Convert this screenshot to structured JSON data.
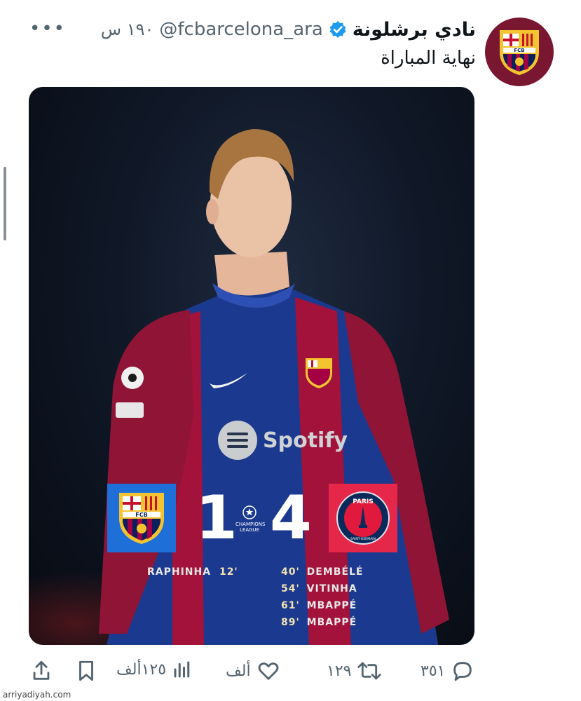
{
  "tweet": {
    "display_name": "نادي برشلونة",
    "handle": "@fcbarcelona_ara",
    "time": "١٩٠ س",
    "more_label": "•••",
    "text": "نهاية المباراة",
    "avatar_label": "FCB"
  },
  "scoreboard": {
    "home_score": "1",
    "away_score": "4",
    "competition": "CHAMPIONS LEAGUE",
    "home_crest_label": "FCB",
    "away_crest_label": "PARIS",
    "away_crest_sub": "SAINT-GERMAIN",
    "sponsor": "Spotify",
    "home_scorers": [
      {
        "player": "RAPHINHA",
        "minute": "12'"
      }
    ],
    "away_scorers": [
      {
        "minute": "40'",
        "player": "DEMBÉLÉ"
      },
      {
        "minute": "54'",
        "player": "VITINHA"
      },
      {
        "minute": "61'",
        "player": "MBAPPÉ"
      },
      {
        "minute": "89'",
        "player": "MBAPPÉ"
      }
    ]
  },
  "actions": {
    "replies": "٣٥١",
    "retweets": "١٢٩",
    "likes": "ألف",
    "views": "١٢٥ألف"
  },
  "watermark": "arriyadiyah.com",
  "colors": {
    "barca_blue": "#1f6fd8",
    "psg_red": "#e5284a",
    "avatar_bg": "#7a1730",
    "verified": "#1d9bf0"
  }
}
